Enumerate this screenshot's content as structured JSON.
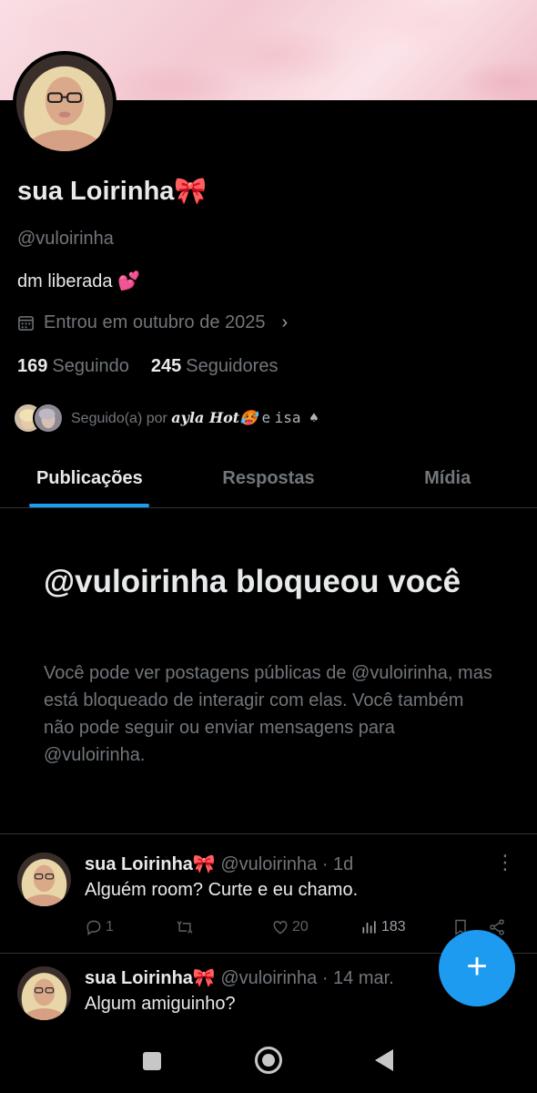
{
  "profile": {
    "name": "sua Loirinha🎀",
    "handle": "@vuloirinha",
    "bio": "dm liberada 💕",
    "joined": "Entrou em outubro de 2025",
    "following_count": "169",
    "following_label": "Seguindo",
    "followers_count": "245",
    "followers_label": "Seguidores",
    "followed_by_prefix": "Seguido(a) por",
    "followed_by_user1": "ayla Hot🥵",
    "followed_by_sep": "e",
    "followed_by_user2": "isa ♠"
  },
  "tabs": [
    {
      "label": "Publicações",
      "active": true
    },
    {
      "label": "Respostas",
      "active": false
    },
    {
      "label": "Mídia",
      "active": false
    }
  ],
  "blocked": {
    "title": "@vuloirinha bloqueou você",
    "body": "Você pode ver postagens públicas de @vuloirinha, mas está bloqueado de interagir com elas. Você também não pode seguir ou enviar mensagens para @vuloirinha."
  },
  "posts": [
    {
      "name": "sua Loirinha🎀",
      "meta": "@vuloirinha · 1d",
      "text": "Alguém room? Curte e eu chamo.",
      "replies": "1",
      "likes": "20",
      "views": "183"
    },
    {
      "name": "sua Loirinha🎀",
      "meta": "@vuloirinha · 14 mar.",
      "text": "Algum amiguinho?"
    }
  ],
  "fab_label": "+",
  "icons": [
    "calendar-icon",
    "chevron-right-icon",
    "reply-icon",
    "retweet-icon",
    "heart-icon",
    "views-icon",
    "bookmark-icon",
    "share-icon",
    "more-icon",
    "compose-icon"
  ],
  "colors": {
    "accent": "#1d9bf0",
    "background": "#000000",
    "muted": "#71767b"
  }
}
